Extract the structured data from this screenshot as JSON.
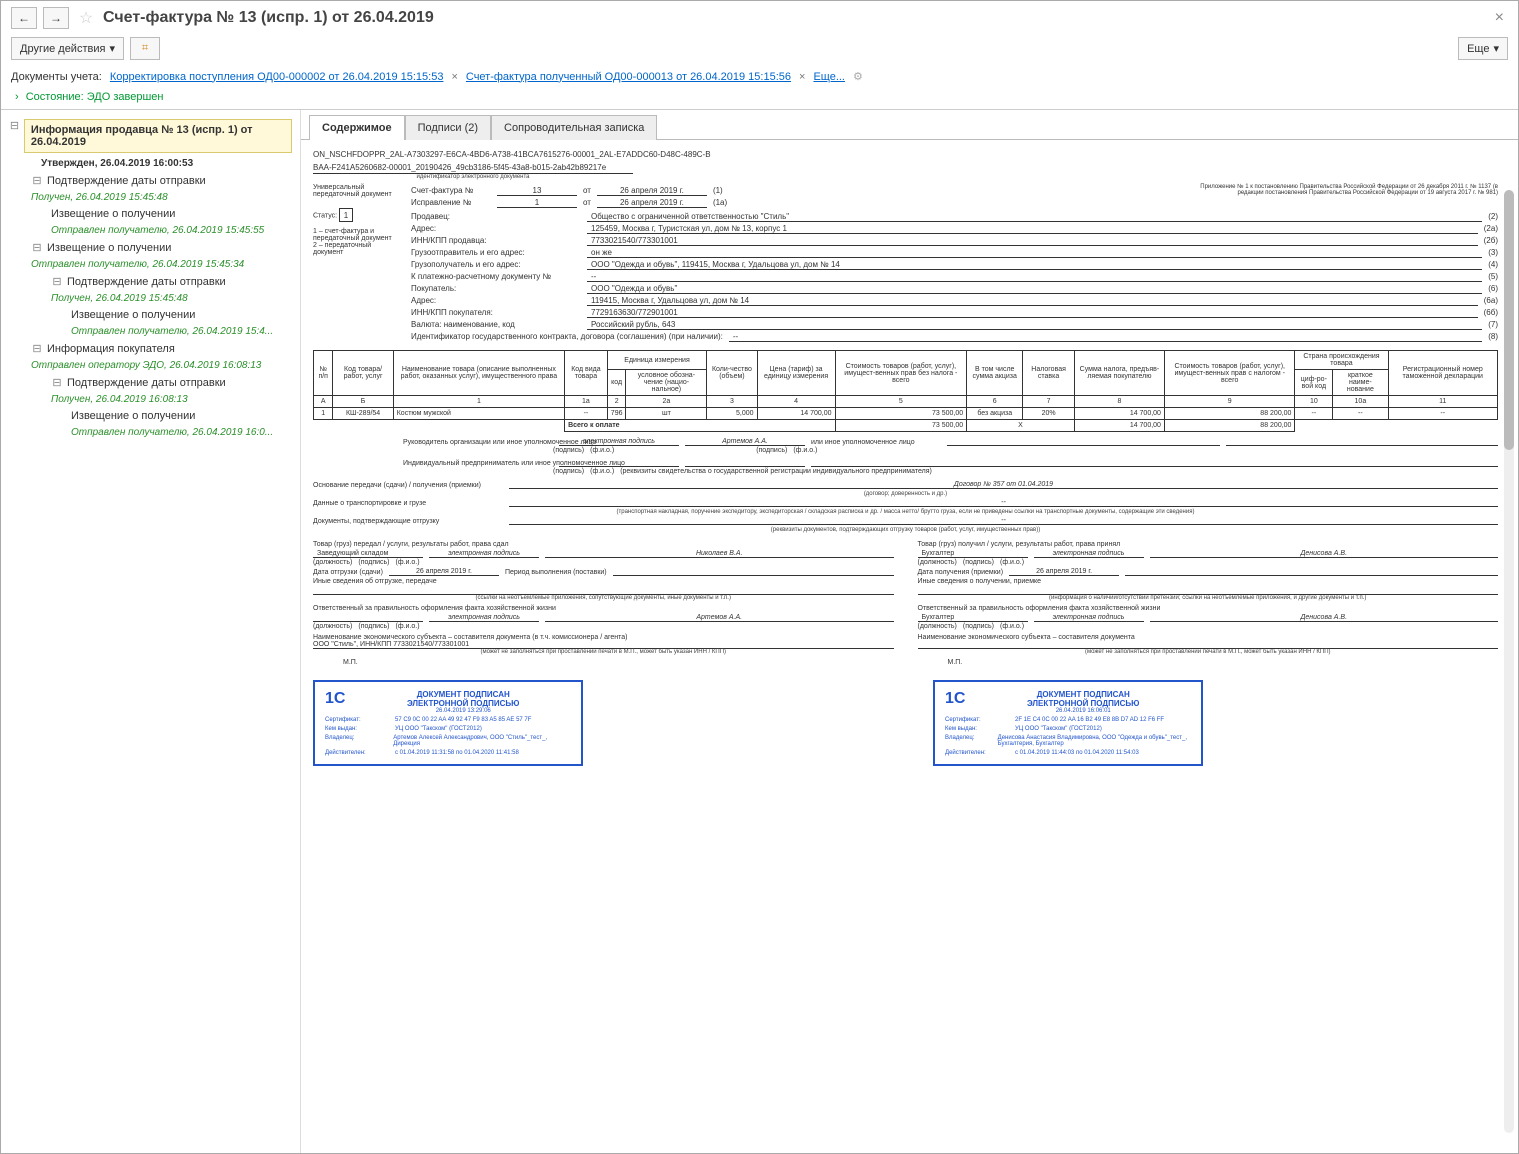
{
  "title": "Счет-фактура № 13 (испр. 1) от 26.04.2019",
  "toolbar": {
    "other_actions": "Другие действия",
    "more": "Еще"
  },
  "docs": {
    "label": "Документы учета:",
    "link1": "Корректировка поступления ОД00-000002 от 26.04.2019 15:15:53",
    "link2": "Счет-фактура полученный ОД00-000013 от 26.04.2019 15:15:56",
    "more": "Еще..."
  },
  "state": {
    "label": "Состояние:",
    "value": "ЭДО завершен"
  },
  "tree": {
    "root": "Информация продавца № 13 (испр. 1) от 26.04.2019",
    "approved": "Утвержден, 26.04.2019 16:00:53",
    "n1": "Подтверждение даты отправки",
    "n1s": "Получен, 26.04.2019 15:45:48",
    "n2": "Извещение о получении",
    "n2s": "Отправлен получателю, 26.04.2019 15:45:55",
    "n3": "Извещение о получении",
    "n3s": "Отправлен получателю, 26.04.2019 15:45:34",
    "n4": "Подтверждение даты отправки",
    "n4s": "Получен, 26.04.2019 15:45:48",
    "n5": "Извещение о получении",
    "n5s": "Отправлен получателю, 26.04.2019 15:4...",
    "n6": "Информация покупателя",
    "n6s": "Отправлен оператору ЭДО, 26.04.2019 16:08:13",
    "n7": "Подтверждение даты отправки",
    "n7s": "Получен, 26.04.2019 16:08:13",
    "n8": "Извещение о получении",
    "n8s": "Отправлен получателю, 26.04.2019 16:0..."
  },
  "tabs": {
    "t1": "Содержимое",
    "t2": "Подписи (2)",
    "t3": "Сопроводительная записка"
  },
  "doc": {
    "id1": "ON_NSCHFDOPPR_2AL-A7303297-E6CA-4BD6-A738-41BCA7615276-00001_2AL-E7ADDC60-D48C-489C-B",
    "id2": "BAA-F241A5260682-00001_20190426_49cb3186-5f45-43a8-b015-2ab42b89217e",
    "idcap": "идентификатор электронного документа",
    "upd": "Универсальный передаточный документ",
    "status_label": "Статус:",
    "status": "1",
    "status_note1": "1 – счет-фактура и передаточный документ",
    "status_note2": "2 – передаточный документ",
    "sf_label": "Счет-фактура №",
    "sf_no": "13",
    "sf_ot": "от",
    "sf_date": "26 апреля 2019 г.",
    "sf_code": "(1)",
    "isp_label": "Исправление №",
    "isp_no": "1",
    "isp_date": "26 апреля 2019 г.",
    "isp_code": "(1а)",
    "note": "Приложение № 1 к постановлению Правительства Российской Федерации от 26 декабря 2011 г. № 1137 (в редакции постановления Правительства Российской Федерации от 19 августа 2017 г. № 981)",
    "seller_l": "Продавец:",
    "seller": "Общество с ограниченной ответственностью \"Стиль\"",
    "seller_c": "(2)",
    "addr_l": "Адрес:",
    "addr": "125459, Москва г, Туристская ул, дом № 13, корпус 1",
    "addr_c": "(2а)",
    "inn_l": "ИНН/КПП продавца:",
    "inn": "7733021540/773301001",
    "inn_c": "(2б)",
    "ship_l": "Грузоотправитель и его адрес:",
    "ship": "он же",
    "ship_c": "(3)",
    "cons_l": "Грузополучатель и его адрес:",
    "cons": "ООО \"Одежда и обувь\", 119415, Москва г, Удальцова ул, дом № 14",
    "cons_c": "(4)",
    "pay_l": "К платежно-расчетному документу №",
    "pay": "--",
    "pay_c": "(5)",
    "buyer_l": "Покупатель:",
    "buyer": "ООО \"Одежда и обувь\"",
    "buyer_c": "(6)",
    "baddr_l": "Адрес:",
    "baddr": "119415, Москва г, Удальцова ул, дом № 14",
    "baddr_c": "(6а)",
    "binn_l": "ИНН/КПП покупателя:",
    "binn": "7729163630/772901001",
    "binn_c": "(6б)",
    "cur_l": "Валюта: наименование, код",
    "cur": "Российский рубль, 643",
    "cur_c": "(7)",
    "gos_l": "Идентификатор государственного контракта, договора (соглашения) (при наличии):",
    "gos": "--",
    "gos_c": "(8)"
  },
  "tableHead": {
    "c1": "№ п/п",
    "c2": "Код товара/ работ, услуг",
    "c3": "Наименование товара (описание выполненных работ, оказанных услуг), имущественного права",
    "c4": "Код вида товара",
    "c5": "Единица измерения",
    "c5a": "код",
    "c5b": "условное обозна-чение (нацио-нальное)",
    "c6": "Коли-чество (объем)",
    "c7": "Цена (тариф) за единицу измерения",
    "c8": "Стоимость товаров (работ, услуг), имущест-венных прав без налога - всего",
    "c9": "В том числе сумма акциза",
    "c10": "Налоговая ставка",
    "c11": "Сумма налога, предъяв-ляемая покупателю",
    "c12": "Стоимость товаров (работ, услуг), имущест-венных прав с налогом - всего",
    "c13": "Страна происхождения товара",
    "c13a": "циф-ро-вой код",
    "c13b": "краткое наиме-нование",
    "c14": "Регистрационный номер таможенной декларации",
    "r2": [
      "А",
      "Б",
      "1",
      "1а",
      "2",
      "2а",
      "3",
      "4",
      "5",
      "6",
      "7",
      "8",
      "9",
      "10",
      "10а",
      "11"
    ]
  },
  "row": {
    "n": "1",
    "code": "КШ-289/54",
    "name": "Костюм мужской",
    "vid": "--",
    "ucode": "796",
    "unit": "шт",
    "qty": "5,000",
    "price": "14 700,00",
    "sum": "73 500,00",
    "akc": "без акциза",
    "rate": "20%",
    "tax": "14 700,00",
    "total": "88 200,00",
    "cc": "--",
    "cn": "--",
    "td": "--"
  },
  "totals": {
    "label": "Всего к оплате",
    "sum": "73 500,00",
    "x": "Х",
    "tax": "14 700,00",
    "total": "88 200,00"
  },
  "sig": {
    "dir_l": "Руководитель организации или иное уполномоченное лицо",
    "ep": "электронная подпись",
    "dir_name": "Артемов А.А.",
    "other_l": "или иное уполномоченное лицо",
    "podpis": "(подпись)",
    "fio": "(ф.и.о.)",
    "ip_l": "Индивидуальный предприниматель или иное уполномоченное лицо",
    "rekv": "(реквизиты свидетельства о государственной регистрации индивидуального предпринимателя)",
    "osn_l": "Основание передачи (сдачи) / получения (приемки)",
    "osn": "Договор № 357 от 01.04.2019",
    "osn_cap": "(договор; доверенность и др.)",
    "trans_l": "Данные о транспортировке и грузе",
    "trans": "--",
    "trans_cap": "(транспортная накладная, поручение экспедитору, экспедиторская / складская расписка и др. / масса нетто/ брутто груза, если не приведены ссылки на транспортные документы, содержащие эти сведения)",
    "confirm_l": "Документы, подтверждающие отгрузку",
    "confirm": "--",
    "confirm_cap": "(реквизиты документов, подтверждающих отгрузку товаров (работ, услуг, имущественных прав))",
    "left_title": "Товар (груз) передал / услуги, результаты работ, права сдал",
    "left_pos": "Заведующий складом",
    "left_name": "Николаев В.А.",
    "left_date_l": "Дата отгрузки (сдачи)",
    "left_date": "26 апреля 2019 г.",
    "left_period_l": "Период выполнения (поставки)",
    "left_other_l": "Иные сведения об отгрузке, передаче",
    "left_other_cap": "(ссылки на неотъемлемые приложения, сопутствующие документы, иные документы и т.п.)",
    "left_resp_l": "Ответственный за правильность оформления факта хозяйственной жизни",
    "left_resp_name": "Артемов А.А.",
    "left_subj_l": "Наименование экономического субъекта – составителя документа (в т.ч. комиссионера / агента)",
    "left_subj": "ООО \"Стиль\", ИНН/КПП 7733021540/773301001",
    "mp": "М.П.",
    "dolzh": "(должность)",
    "mpcap": "(может не заполняться при проставлении печати в М.П., может быть указан ИНН / КПП)",
    "right_title": "Товар (груз) получил / услуги, результаты работ, права принял",
    "right_pos": "Бухгалтер",
    "right_name": "Денисова А.В.",
    "right_date_l": "Дата получения (приемки)",
    "right_date": "26 апреля 2019 г.",
    "right_other_l": "Иные сведения о получении, приемке",
    "right_other_cap": "(информация о наличии/отсутствии претензии; ссылки на неотъемлемые приложения, и другие документы и т.п.)",
    "right_resp_l": "Ответственный за правильность оформления факта хозяйственной жизни",
    "right_subj_l": "Наименование экономического субъекта – составителя документа"
  },
  "stamp1": {
    "title1": "ДОКУМЕНТ ПОДПИСАН",
    "title2": "ЭЛЕКТРОННОЙ ПОДПИСЬЮ",
    "date": "26.04.2019 13:29:06",
    "cert_l": "Сертификат:",
    "cert": "57 C9 0C 00 22 AA 49 92 47 F9 83 A5 85 AE 57 7F",
    "kem_l": "Кем выдан:",
    "kem": "УЦ ООО \"Такском\" (ГОСТ2012)",
    "own_l": "Владелец:",
    "own": "Артемов Алексей Александрович, ООО \"Стиль\"_тест_, Дирекция",
    "val_l": "Действителен:",
    "val": "с 01.04.2019 11:31:58 по 01.04.2020 11:41:58"
  },
  "stamp2": {
    "title1": "ДОКУМЕНТ ПОДПИСАН",
    "title2": "ЭЛЕКТРОННОЙ ПОДПИСЬЮ",
    "date": "26.04.2019 16:06:01",
    "cert_l": "Сертификат:",
    "cert": "2F 1E C4 0C 00 22 AA 16 B2 49 E8 8B D7 AD 12 F6 FF",
    "kem_l": "Кем выдан:",
    "kem": "УЦ ООО \"Такском\" (ГОСТ2012)",
    "own_l": "Владелец:",
    "own": "Денисова Анастасия Владимировна, ООО \"Одежда и обувь\"_тест_, Бухгалтерия, Бухгалтер",
    "val_l": "Действителен:",
    "val": "с 01.04.2019 11:44:03 по 01.04.2020 11:54:03"
  }
}
